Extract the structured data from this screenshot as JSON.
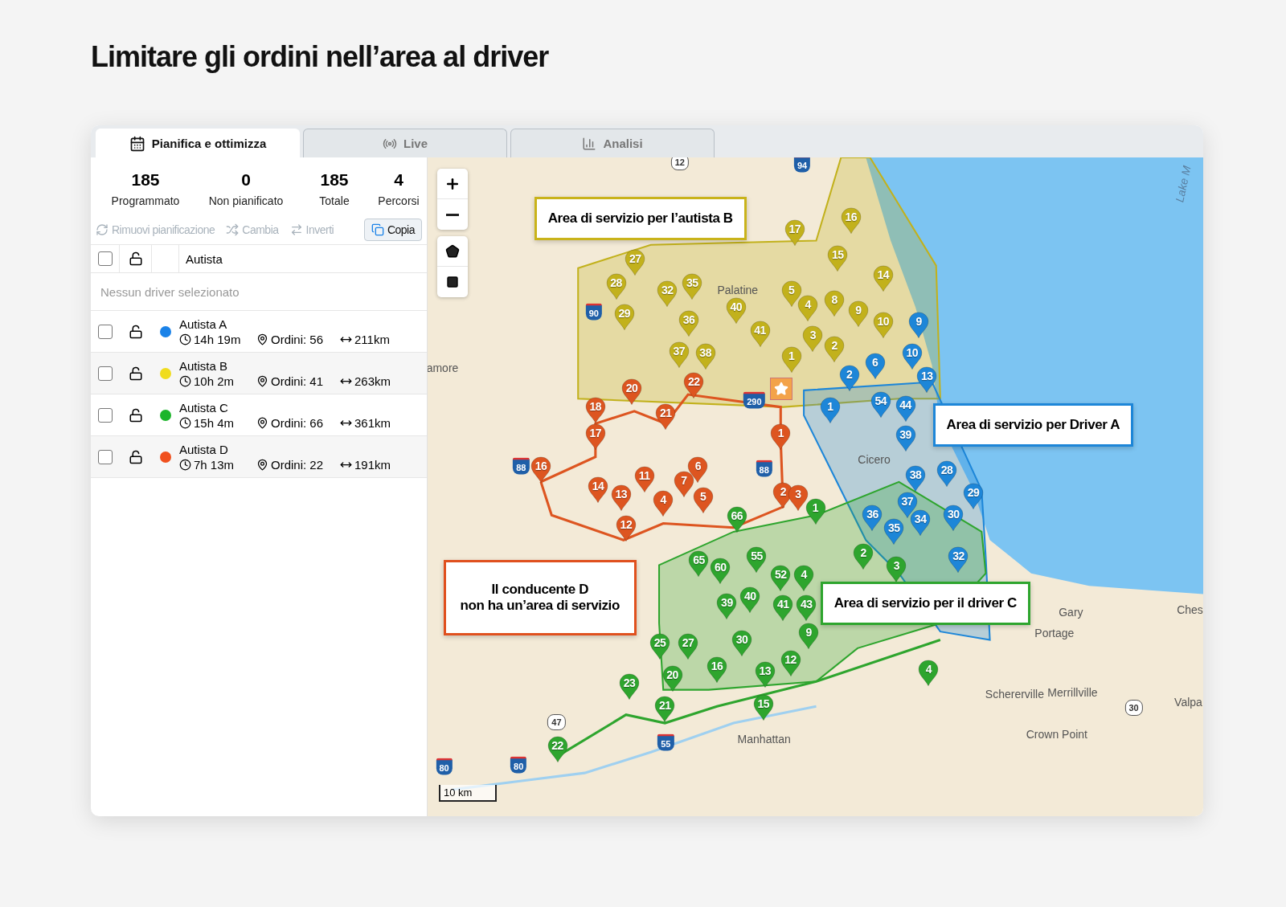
{
  "page_title": "Limitare gli ordini nell’area al driver",
  "tabs": [
    {
      "label": "Pianifica e ottimizza",
      "selected": true
    },
    {
      "label": "Live",
      "selected": false
    },
    {
      "label": "Analisi",
      "selected": false
    }
  ],
  "stats": [
    {
      "value": "185",
      "label": "Programmato"
    },
    {
      "value": "0",
      "label": "Non pianificato"
    },
    {
      "value": "185",
      "label": "Totale"
    },
    {
      "value": "4",
      "label": "Percorsi"
    }
  ],
  "actions": [
    {
      "label": "Rimuovi pianificazione",
      "disabled": true
    },
    {
      "label": "Cambia",
      "disabled": true
    },
    {
      "label": "Inverti",
      "disabled": true
    },
    {
      "label": "Copia",
      "disabled": false
    }
  ],
  "table": {
    "header_checked": false,
    "column": "Autista",
    "empty_text": "Nessun driver selezionato",
    "rows": [
      {
        "name": "Autista A",
        "color": "#1a82e8",
        "checked": false,
        "duration": "14h 19m",
        "orders": "Ordini: 56",
        "distance": "211km"
      },
      {
        "name": "Autista B",
        "color": "#f0dc1e",
        "checked": false,
        "duration": "10h 2m",
        "orders": "Ordini: 41",
        "distance": "263km"
      },
      {
        "name": "Autista C",
        "color": "#1cb52b",
        "checked": false,
        "duration": "15h 4m",
        "orders": "Ordini: 66",
        "distance": "361km"
      },
      {
        "name": "Autista D",
        "color": "#f0501e",
        "checked": false,
        "duration": "7h 13m",
        "orders": "Ordini: 22",
        "distance": "191km"
      }
    ]
  },
  "map": {
    "routes": [
      {
        "color": "#c2b11c",
        "pins": [
          "16",
          "17",
          "27",
          "15",
          "14",
          "28",
          "32",
          "35",
          "5",
          "8",
          "29",
          "40",
          "4",
          "9",
          "10",
          "36",
          "41",
          "3",
          "37",
          "38",
          "1",
          "2"
        ]
      },
      {
        "color": "#1d86d8",
        "pins": [
          "9",
          "10",
          "6",
          "2",
          "13",
          "1",
          "54",
          "44",
          "39",
          "28",
          "38",
          "29",
          "37",
          "36",
          "35",
          "34",
          "30",
          "32"
        ]
      },
      {
        "color": "#dd5520",
        "pins": [
          "20",
          "22",
          "18",
          "21",
          "17",
          "1",
          "16",
          "6",
          "11",
          "7",
          "14",
          "13",
          "4",
          "5",
          "2",
          "3",
          "12"
        ]
      },
      {
        "color": "#2ea52e",
        "pins": [
          "1",
          "66",
          "2",
          "3",
          "65",
          "60",
          "55",
          "52",
          "4",
          "39",
          "40",
          "41",
          "43",
          "9",
          "25",
          "27",
          "30",
          "16",
          "12",
          "13",
          "20",
          "23",
          "21",
          "15",
          "22",
          "4"
        ]
      }
    ],
    "callouts": [
      {
        "text": "Area di servizio per l’autista B",
        "color": "#c9b31a"
      },
      {
        "text": "Area di servizio per Driver A",
        "color": "#1d86d8"
      },
      {
        "text": "Il conducente D\nnon ha un’area di servizio",
        "color": "#e0501e"
      },
      {
        "text": "Area di servizio per il driver C",
        "color": "#2ea52e"
      }
    ],
    "places": [
      "Palatine",
      "Cicero",
      "amore",
      "Gary",
      "Portage",
      "Schererville",
      "Merrillville",
      "Crown Point",
      "Manhattan",
      "Valpa",
      "Ches",
      "Lake M"
    ],
    "shields": [
      {
        "label": "12",
        "kind": "us"
      },
      {
        "label": "94",
        "kind": "interstate"
      },
      {
        "label": "90",
        "kind": "interstate"
      },
      {
        "label": "290",
        "kind": "interstate"
      },
      {
        "label": "88",
        "kind": "interstate"
      },
      {
        "label": "88",
        "kind": "interstate"
      },
      {
        "label": "47",
        "kind": "us"
      },
      {
        "label": "55",
        "kind": "interstate"
      },
      {
        "label": "80",
        "kind": "interstate"
      },
      {
        "label": "80",
        "kind": "interstate"
      },
      {
        "label": "30",
        "kind": "us"
      }
    ],
    "scale": "10 km"
  }
}
